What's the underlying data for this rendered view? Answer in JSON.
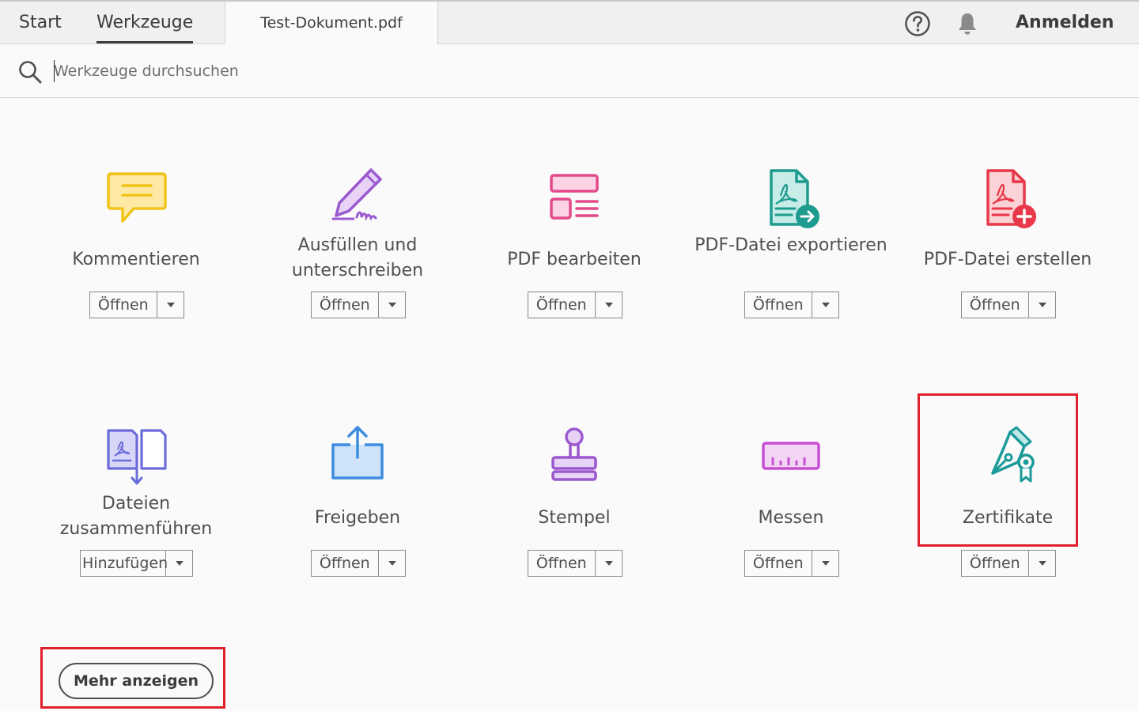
{
  "header": {
    "tabs": [
      {
        "label": "Start"
      },
      {
        "label": "Werkzeuge",
        "active": true
      }
    ],
    "document_tab": "Test-Dokument.pdf",
    "help_icon": "help-icon",
    "notifications_icon": "bell-icon",
    "signin_label": "Anmelden"
  },
  "search": {
    "placeholder": "Werkzeuge durchsuchen",
    "value": "",
    "icon": "search-icon"
  },
  "tools": [
    {
      "name": "Kommentieren",
      "icon": "comment-icon",
      "action": "Öffnen",
      "color": "#f0c419"
    },
    {
      "name": "Ausfüllen und unterschreiben",
      "icon": "fill-sign-icon",
      "action": "Öffnen",
      "color": "#9b59d0"
    },
    {
      "name": "PDF bearbeiten",
      "icon": "edit-pdf-icon",
      "action": "Öffnen",
      "color": "#e34a8a"
    },
    {
      "name": "PDF-Datei exportieren",
      "icon": "export-pdf-icon",
      "action": "Öffnen",
      "color": "#1e9b8f"
    },
    {
      "name": "PDF-Datei erstellen",
      "icon": "create-pdf-icon",
      "action": "Öffnen",
      "color": "#e8394a"
    },
    {
      "name": "Dateien zusammenführen",
      "icon": "combine-files-icon",
      "action": "Hinzufügen",
      "color": "#6b6bdc"
    },
    {
      "name": "Freigeben",
      "icon": "share-icon",
      "action": "Öffnen",
      "color": "#3d8ce0"
    },
    {
      "name": "Stempel",
      "icon": "stamp-icon",
      "action": "Öffnen",
      "color": "#9b59d0"
    },
    {
      "name": "Messen",
      "icon": "measure-icon",
      "action": "Öffnen",
      "color": "#c74fd6"
    },
    {
      "name": "Zertifikate",
      "icon": "certificate-icon",
      "action": "Öffnen",
      "color": "#1a9a98"
    }
  ],
  "more_label": "Mehr anzeigen",
  "highlight_color": "#e0202c"
}
